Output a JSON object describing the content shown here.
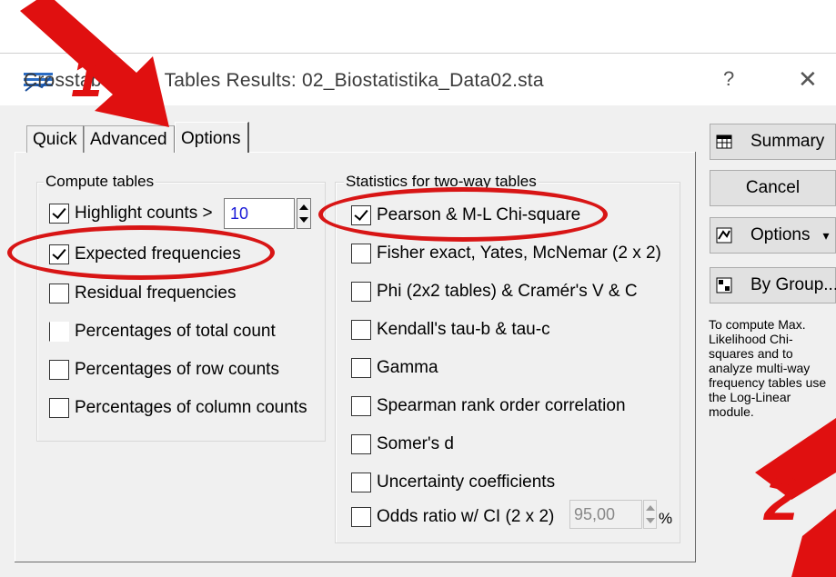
{
  "window": {
    "title": "Crosstabulation Tables Results: 02_Biostatistika_Data02.sta",
    "help_glyph": "?",
    "close_glyph": "✕"
  },
  "tabs": [
    {
      "label": "Quick",
      "active": false
    },
    {
      "label": "Advanced",
      "active": false
    },
    {
      "label": "Options",
      "active": true
    }
  ],
  "compute_tables": {
    "title": "Compute tables",
    "items": [
      {
        "label": "Highlight counts >",
        "checked": true
      },
      {
        "label": "Expected frequencies",
        "checked": true
      },
      {
        "label": "Residual frequencies",
        "checked": false
      },
      {
        "label": "Percentages of total count",
        "checked": false
      },
      {
        "label": "Percentages of row counts",
        "checked": false
      },
      {
        "label": "Percentages of column counts",
        "checked": false
      }
    ],
    "highlight_value": "10"
  },
  "two_way": {
    "title": "Statistics for two-way tables",
    "items": [
      {
        "label": "Pearson & M-L Chi-square",
        "checked": true
      },
      {
        "label": "Fisher exact, Yates, McNemar (2 x 2)",
        "checked": false
      },
      {
        "label": "Phi (2x2 tables) & Cramér's V & C",
        "checked": false
      },
      {
        "label": "Kendall's tau-b & tau-c",
        "checked": false
      },
      {
        "label": "Gamma",
        "checked": false
      },
      {
        "label": "Spearman rank order correlation",
        "checked": false
      },
      {
        "label": "Somer's d",
        "checked": false
      },
      {
        "label": "Uncertainty coefficients",
        "checked": false
      },
      {
        "label": "Odds ratio w/ CI (2 x 2)",
        "checked": false
      }
    ],
    "odds_value": "95,00",
    "odds_unit": "%"
  },
  "buttons": {
    "summary": "Summary",
    "cancel": "Cancel",
    "options": "Options",
    "options_arrow": "▾",
    "by_group": "By Group..."
  },
  "side_note": "To compute Max. Likelihood Chi-squares and to analyze multi-way frequency tables use the Log-Linear module.",
  "annotations": {
    "marker_1": "1",
    "marker_2": "2",
    "color": "#e01010"
  }
}
